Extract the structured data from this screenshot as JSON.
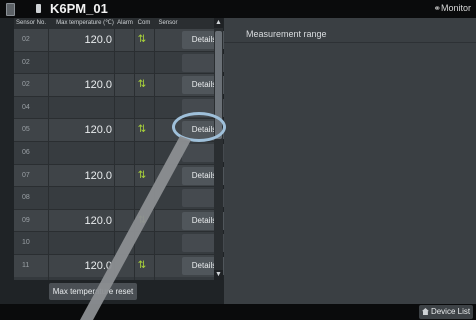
{
  "title": "K6PM_01",
  "monitor_label": "Monitor",
  "table": {
    "headers": [
      "Sensor No.",
      "Max temperature (℃)",
      "Alarm",
      "Com",
      "Sensor"
    ],
    "rows": [
      {
        "no": "02",
        "value": "120.0",
        "details": "Details"
      },
      {
        "no": "02",
        "value": "",
        "details": ""
      },
      {
        "no": "02",
        "value": "120.0",
        "details": "Details"
      },
      {
        "no": "04",
        "value": "",
        "details": ""
      },
      {
        "no": "05",
        "value": "120.0",
        "details": "Details"
      },
      {
        "no": "06",
        "value": "",
        "details": ""
      },
      {
        "no": "07",
        "value": "120.0",
        "details": "Details"
      },
      {
        "no": "08",
        "value": "",
        "details": ""
      },
      {
        "no": "09",
        "value": "120.0",
        "details": "Details"
      },
      {
        "no": "10",
        "value": "",
        "details": ""
      },
      {
        "no": "11",
        "value": "120.0",
        "details": "Details"
      }
    ]
  },
  "panel": {
    "title": "Measurement range"
  },
  "reset_button": "Max temperature reset",
  "device_list_button": "Device List",
  "icons": {
    "com_ok": "green-arrows-icon",
    "home": "home-icon",
    "scroll_up": "chevron-up-icon",
    "scroll_down": "chevron-down-icon"
  },
  "colors": {
    "accent_green": "#a8d13a",
    "highlight": "#9fc0da"
  }
}
